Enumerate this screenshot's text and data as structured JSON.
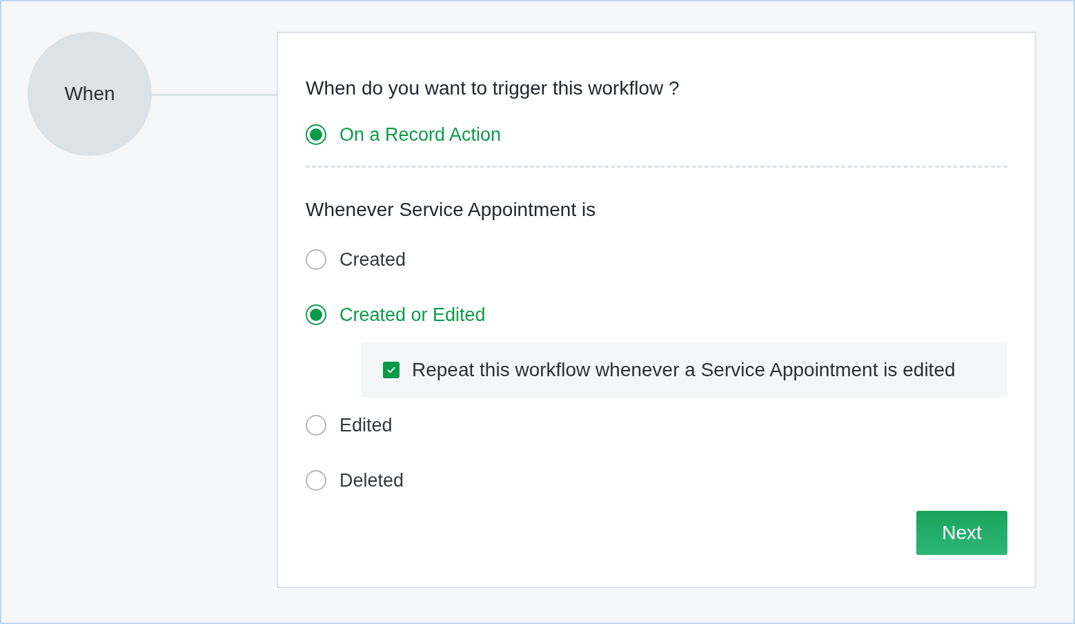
{
  "step": {
    "label": "When"
  },
  "question": "When do you want to trigger this workflow ?",
  "triggers": [
    {
      "label": "On a Record Action",
      "selected": true
    }
  ],
  "section_heading": "Whenever Service Appointment is",
  "options": [
    {
      "label": "Created",
      "selected": false
    },
    {
      "label": "Created or Edited",
      "selected": true,
      "sub_option": {
        "label": "Repeat this workflow whenever a Service Appointment is edited",
        "checked": true
      }
    },
    {
      "label": "Edited",
      "selected": false
    },
    {
      "label": "Deleted",
      "selected": false
    }
  ],
  "next_button": "Next"
}
